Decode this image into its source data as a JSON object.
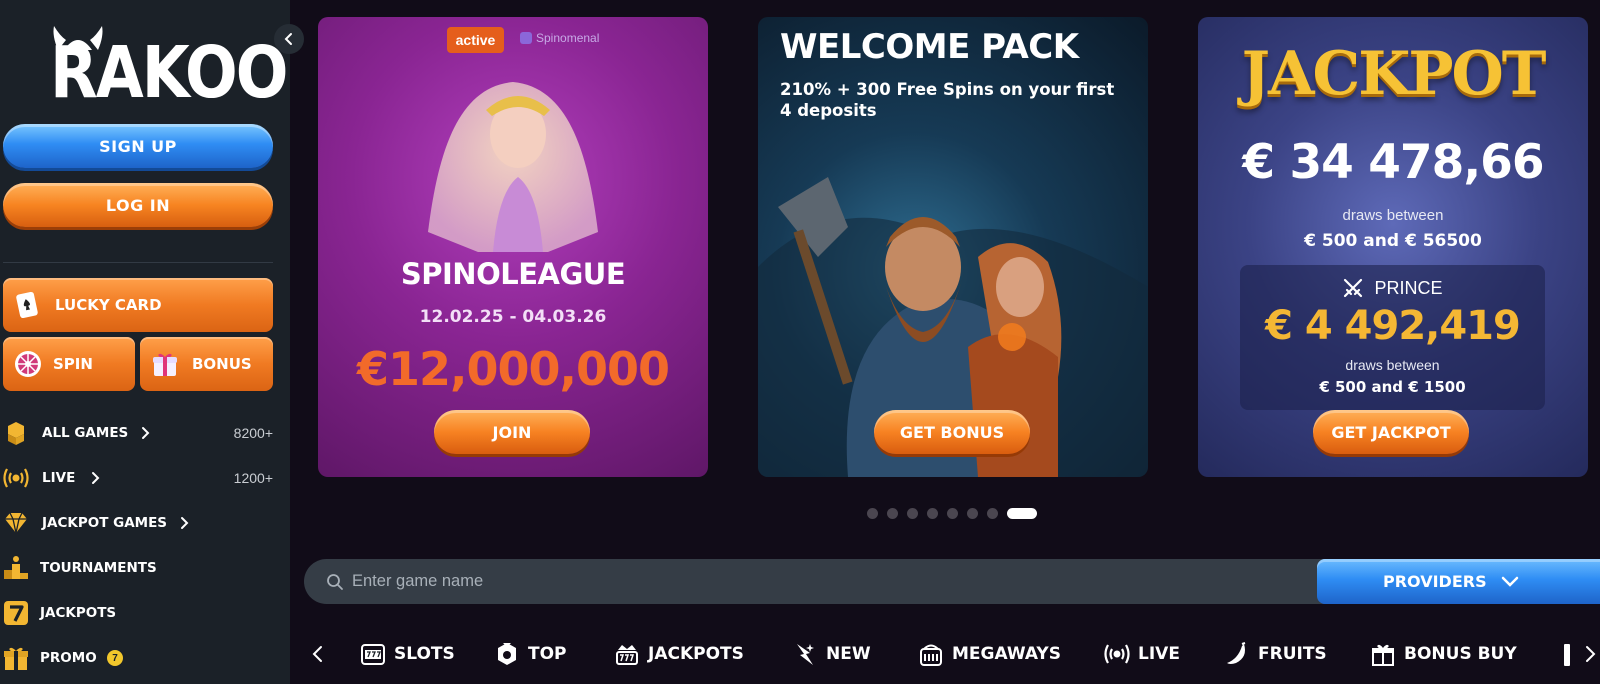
{
  "sidebar": {
    "logo": "RAKOO",
    "signup_label": "SIGN UP",
    "login_label": "LOG IN",
    "lucky_card_label": "LUCKY CARD",
    "spin_label": "SPIN",
    "bonus_label": "BONUS",
    "nav": [
      {
        "label": "ALL GAMES",
        "count": "8200+",
        "icon": "cubes-icon"
      },
      {
        "label": "LIVE",
        "count": "1200+",
        "icon": "broadcast-icon"
      },
      {
        "label": "JACKPOT GAMES",
        "icon": "diamond-icon"
      },
      {
        "label": "TOURNAMENTS",
        "icon": "podium-icon"
      },
      {
        "label": "JACKPOTS",
        "icon": "seven-icon"
      },
      {
        "label": "PROMO",
        "badge": "7",
        "icon": "gift-icon"
      }
    ]
  },
  "cards": {
    "spinoleague": {
      "tag": "active",
      "provider": "Spinomenal",
      "title": "SPINOLEAGUE",
      "dates": "12.02.25 - 04.03.26",
      "prize": "€12,000,000",
      "button": "JOIN"
    },
    "welcome": {
      "title": "WELCOME PACK",
      "subtitle": "210% + 300 Free Spins on your first 4 deposits",
      "button": "GET BONUS"
    },
    "jackpot": {
      "title": "JACKPOT",
      "amount": "€ 34 478,66",
      "draws_label": "draws between",
      "draws_range": "€ 500 and € 56500",
      "prince_label": "PRINCE",
      "prince_amount": "€ 4 492,419",
      "prince_draws_label": "draws between",
      "prince_draws_range": "€ 500 and € 1500",
      "button": "GET JACKPOT"
    }
  },
  "carousel": {
    "total": 8,
    "active_index": 7
  },
  "search": {
    "placeholder": "Enter game name",
    "providers_label": "PROVIDERS"
  },
  "categories": [
    {
      "label": "SLOTS",
      "icon": "slot-machine-icon"
    },
    {
      "label": "TOP",
      "icon": "top-badge-icon"
    },
    {
      "label": "JACKPOTS",
      "icon": "jackpot-icon"
    },
    {
      "label": "NEW",
      "icon": "new-star-icon"
    },
    {
      "label": "MEGAWAYS",
      "icon": "megaways-icon"
    },
    {
      "label": "LIVE",
      "icon": "live-icon"
    },
    {
      "label": "FRUITS",
      "icon": "banana-icon"
    },
    {
      "label": "BONUS BUY",
      "icon": "gift-icon"
    }
  ],
  "colors": {
    "sidebar_bg": "#1b2128",
    "page_bg": "#110c18",
    "accent_orange": "#f78222",
    "accent_blue": "#2f8df4",
    "gold": "#f4b734"
  }
}
